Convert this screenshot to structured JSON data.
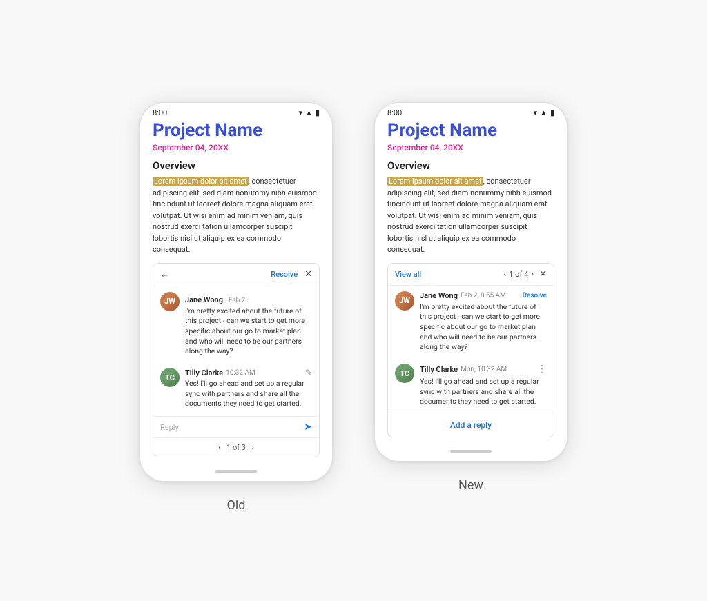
{
  "comparison": {
    "old_label": "Old",
    "new_label": "New"
  },
  "shared": {
    "status_time": "8:00",
    "doc_title": "Project Name",
    "doc_date": "September 04, 20XX",
    "overview_title": "Overview",
    "doc_body_highlight": "Lorem ipsum dolor sit amet",
    "doc_body_rest": ", consectetuer adipiscing elit, sed diam nonummy nibh euismod tincindunt ut laoreet dolore magna aliquam erat volutpat. Ut wisi enim ad minim veniam, quis nostrud exerci tation ullamcorper suscipit lobortis nisl ut aliquip ex ea commodo consequat."
  },
  "old_phone": {
    "comment_panel_back": "←",
    "comment_panel_resolve": "Resolve",
    "comment_panel_close": "✕",
    "jane_name": "Jane Wong",
    "jane_date": "Feb 2",
    "jane_text": "I'm pretty excited about the future of this project - can we start to get more specific about our go to market plan and who will need to be our partners along the way?",
    "tilly_name": "Tilly Clarke",
    "tilly_time": "10:32 AM",
    "tilly_text": "Yes! I'll go ahead and set up a regular sync with partners and share all the documents they need to get started.",
    "reply_placeholder": "Reply",
    "pagination": "1 of 3"
  },
  "new_phone": {
    "view_all": "View all",
    "pagination": "1 of 4",
    "close": "✕",
    "jane_name": "Jane Wong",
    "jane_datetime": "Feb 2, 8:55 AM",
    "jane_resolve": "Resolve",
    "jane_text": "I'm pretty excited about the future of this project - can we start to get more specific about our go to market plan and who will need to be our partners along the way?",
    "tilly_name": "Tilly Clarke",
    "tilly_time": "Mon, 10:32 AM",
    "tilly_text": "Yes! I'll go ahead and set up a regular sync with partners and share all the documents they need to get started.",
    "add_reply": "Add a reply"
  },
  "icons": {
    "wifi": "▲",
    "signal": "■",
    "battery": "▮"
  }
}
